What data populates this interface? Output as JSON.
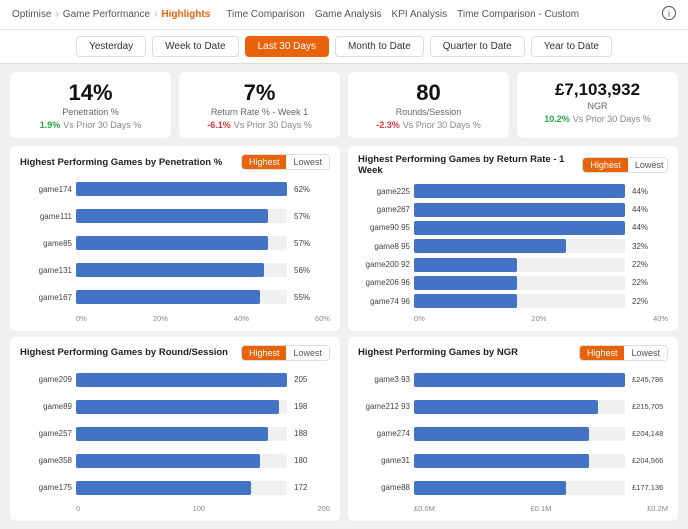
{
  "nav": {
    "breadcrumbs": [
      "Optimise",
      "Game Performance",
      "Highlights"
    ],
    "tabs": [
      "Time Comparison",
      "Game Analysis",
      "KPI Analysis",
      "Time Comparison - Custom"
    ]
  },
  "dateTabs": [
    "Yesterday",
    "Week to Date",
    "Last 30 Days",
    "Month to Date",
    "Quarter to Date",
    "Year to Date"
  ],
  "activeDateTab": "Last 30 Days",
  "kpis": [
    {
      "value": "14%",
      "label": "Penetration %",
      "change": "1.9%",
      "changeDesc": "Vs Prior 30 Days %",
      "positive": true
    },
    {
      "value": "7%",
      "label": "Return Rate % - Week 1",
      "change": "-6.1%",
      "changeDesc": "Vs Prior 30 Days %",
      "positive": false
    },
    {
      "value": "80",
      "label": "Rounds/Session",
      "change": "-2.3%",
      "changeDesc": "Vs Prior 30 Days %",
      "positive": false
    },
    {
      "value": "£7,103,932",
      "label": "NGR",
      "change": "10.2%",
      "changeDesc": "Vs Prior 30 Days %",
      "positive": true
    }
  ],
  "charts": {
    "penetration": {
      "title": "Highest Performing Games by Penetration %",
      "bars": [
        {
          "label": "game174",
          "value": "62%",
          "pct": 100
        },
        {
          "label": "game111",
          "value": "57%",
          "pct": 91
        },
        {
          "label": "game85",
          "value": "57%",
          "pct": 91
        },
        {
          "label": "game131",
          "value": "56%",
          "pct": 89
        },
        {
          "label": "game167",
          "value": "55%",
          "pct": 87
        }
      ],
      "axis": [
        "0%",
        "20%",
        "40%",
        "60%"
      ]
    },
    "returnRate": {
      "title": "Highest Performing Games by Return Rate - 1 Week",
      "bars": [
        {
          "label": "game225",
          "value": "44%",
          "pct": 100
        },
        {
          "label": "game267",
          "value": "44%",
          "pct": 100
        },
        {
          "label": "game90 95",
          "value": "44%",
          "pct": 100
        },
        {
          "label": "game8 95",
          "value": "32%",
          "pct": 72
        },
        {
          "label": "game200 92",
          "value": "22%",
          "pct": 49
        },
        {
          "label": "game206 96",
          "value": "22%",
          "pct": 49
        },
        {
          "label": "game74 96",
          "value": "22%",
          "pct": 49
        }
      ],
      "axis": [
        "0%",
        "20%",
        "40%"
      ]
    },
    "roundsSession": {
      "title": "Highest Performing Games by Round/Session",
      "bars": [
        {
          "label": "game209",
          "value": "205",
          "pct": 100
        },
        {
          "label": "game89",
          "value": "198",
          "pct": 96
        },
        {
          "label": "game257",
          "value": "188",
          "pct": 91
        },
        {
          "label": "game358",
          "value": "180",
          "pct": 87
        },
        {
          "label": "game175",
          "value": "172",
          "pct": 83
        }
      ],
      "axis": [
        "0",
        "100",
        "200"
      ]
    },
    "ngr": {
      "title": "Highest Performing Games by NGR",
      "bars": [
        {
          "label": "game3 93",
          "value": "£245,786",
          "pct": 100
        },
        {
          "label": "game212 93",
          "value": "£215,705",
          "pct": 87
        },
        {
          "label": "game274",
          "value": "£204,148",
          "pct": 83
        },
        {
          "label": "game31",
          "value": "£204,566",
          "pct": 83
        },
        {
          "label": "game88",
          "value": "£177,136",
          "pct": 72
        }
      ],
      "axis": [
        "£0.0M",
        "£0.1M",
        "£0.2M"
      ]
    }
  },
  "toggleLabels": {
    "highest": "Highest",
    "lowest": "Lowest"
  }
}
